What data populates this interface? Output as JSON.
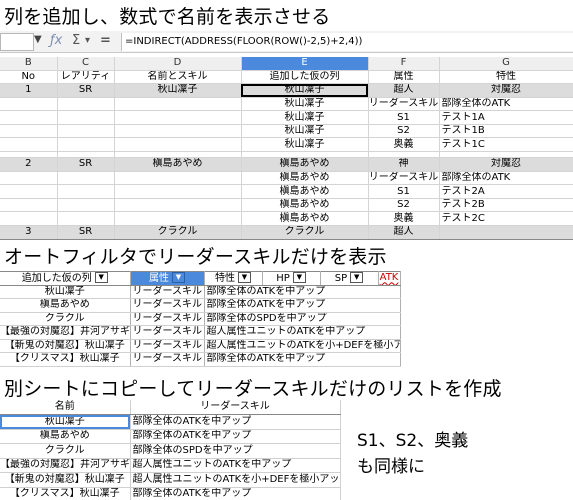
{
  "headings": {
    "step1": "列を追加し、数式で名前を表示させる",
    "step2": "オートフィルタでリーダースキルだけを表示",
    "step3": "別シートにコピーしてリーダースキルだけのリストを作成"
  },
  "formula_bar": {
    "name_box": "",
    "dropdown_icon": "chevron-down-icon",
    "fx_icon": "ƒx",
    "sigma_icon": "Σ",
    "sigma_dropdown": "▾",
    "equals_icon": "=",
    "formula": "=INDIRECT(ADDRESS(FLOOR(ROW()-2,5)+2,4))"
  },
  "grid": {
    "columns": [
      "B",
      "C",
      "D",
      "E",
      "F",
      "G"
    ],
    "selected_column": "E",
    "header": [
      "No",
      "レアリティ",
      "名前とスキル",
      "追加した仮の列",
      "属性",
      "特性"
    ],
    "rows": [
      {
        "kind": "main",
        "cells": [
          "1",
          "SR",
          "秋山凜子",
          "秋山凜子",
          "超人",
          "対魔忍"
        ]
      },
      {
        "kind": "sub",
        "cells": [
          "",
          "",
          "",
          "秋山凜子",
          "リーダースキル",
          "部隊全体のATK"
        ]
      },
      {
        "kind": "sub",
        "cells": [
          "",
          "",
          "",
          "秋山凜子",
          "S1",
          "テスト1A"
        ]
      },
      {
        "kind": "sub",
        "cells": [
          "",
          "",
          "",
          "秋山凜子",
          "S2",
          "テスト1B"
        ]
      },
      {
        "kind": "sub",
        "cells": [
          "",
          "",
          "",
          "秋山凜子",
          "奥義",
          "テスト1C"
        ]
      },
      {
        "kind": "main",
        "cells": [
          "2",
          "SR",
          "槇島あやめ",
          "槇島あやめ",
          "神",
          "対魔忍"
        ]
      },
      {
        "kind": "sub",
        "cells": [
          "",
          "",
          "",
          "槇島あやめ",
          "リーダースキル",
          "部隊全体のATK"
        ]
      },
      {
        "kind": "sub",
        "cells": [
          "",
          "",
          "",
          "槇島あやめ",
          "S1",
          "テスト2A"
        ]
      },
      {
        "kind": "sub",
        "cells": [
          "",
          "",
          "",
          "槇島あやめ",
          "S2",
          "テスト2B"
        ]
      },
      {
        "kind": "sub",
        "cells": [
          "",
          "",
          "",
          "槇島あやめ",
          "奥義",
          "テスト2C"
        ]
      },
      {
        "kind": "main",
        "cells": [
          "3",
          "SR",
          "クラクル",
          "クラクル",
          "超人",
          ""
        ]
      }
    ]
  },
  "filter": {
    "headers": [
      "追加した仮の列",
      "属性",
      "特性",
      "HP",
      "SP",
      "ATK"
    ],
    "dropdown_glyph": "▼",
    "rows": [
      [
        "秋山凜子",
        "リーダースキル",
        "部隊全体のATKを中アップ"
      ],
      [
        "槇島あやめ",
        "リーダースキル",
        "部隊全体のATKを中アップ"
      ],
      [
        "クラクル",
        "リーダースキル",
        "部隊全体のSPDを中アップ"
      ],
      [
        "【最強の対魔忍】井河アサギ",
        "リーダースキル",
        "超人属性ユニットのATKを中アップ"
      ],
      [
        "【斬鬼の対魔忍】秋山凜子",
        "リーダースキル",
        "超人属性ユニットのATKを小+DEFを極小アップ"
      ],
      [
        "【クリスマス】秋山凜子",
        "リーダースキル",
        "部隊全体のATKを中アップ"
      ]
    ]
  },
  "copy_list": {
    "headers": [
      "名前",
      "リーダースキル"
    ],
    "rows": [
      [
        "秋山凜子",
        "部隊全体のATKを中アップ"
      ],
      [
        "槇島あやめ",
        "部隊全体のATKを中アップ"
      ],
      [
        "クラクル",
        "部隊全体のSPDを中アップ"
      ],
      [
        "【最強の対魔忍】井河アサギ",
        "超人属性ユニットのATKを中アップ"
      ],
      [
        "【斬鬼の対魔忍】秋山凜子",
        "超人属性ユニットのATKを小+DEFを極小アップ"
      ],
      [
        "【クリスマス】秋山凜子",
        "部隊全体のATKを中アップ"
      ]
    ]
  },
  "note": {
    "line1": "S1、S2、奥義",
    "line2": "も同様に"
  },
  "colors": {
    "selection": "#4a89dc",
    "main_row_fill": "#dcdcdc",
    "formula_bar_bg": "#f2f2f2"
  }
}
